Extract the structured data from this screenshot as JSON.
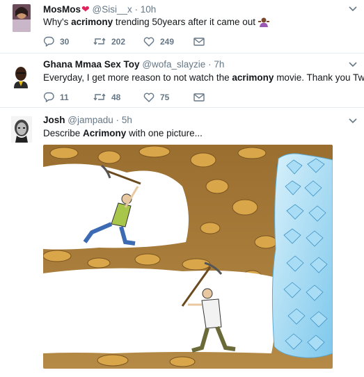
{
  "tweets": [
    {
      "name": "MosMos",
      "handle": "@Sisi__x",
      "time": "10h",
      "text_pre": "Why's ",
      "text_bold": "acrimony",
      "text_post": " trending 50years after it came out",
      "replies": "30",
      "retweets": "202",
      "likes": "249"
    },
    {
      "name": "Ghana Mmaa Sex Toy",
      "handle": "@wofa_slayzie",
      "time": "7h",
      "text_pre": "Everyday, I get more reason to not watch the ",
      "text_bold": "acrimony",
      "text_post": " movie. Thank you Twitter",
      "replies": "11",
      "retweets": "48",
      "likes": "75"
    },
    {
      "name": "Josh",
      "handle": "@jampadu",
      "time": "5h",
      "text_pre": "Describe ",
      "text_bold": "Acrimony",
      "text_post": " with one picture..."
    }
  ],
  "separator": "·",
  "colors": {
    "like": "#e0245e",
    "muted": "#657786",
    "dirt": "#a67c3c",
    "diamond": "#8fd3f4"
  },
  "icons": [
    "heart-icon",
    "reply-icon",
    "retweet-icon",
    "like-icon",
    "message-icon",
    "chevron-down-icon",
    "shrug-emoji-icon"
  ]
}
